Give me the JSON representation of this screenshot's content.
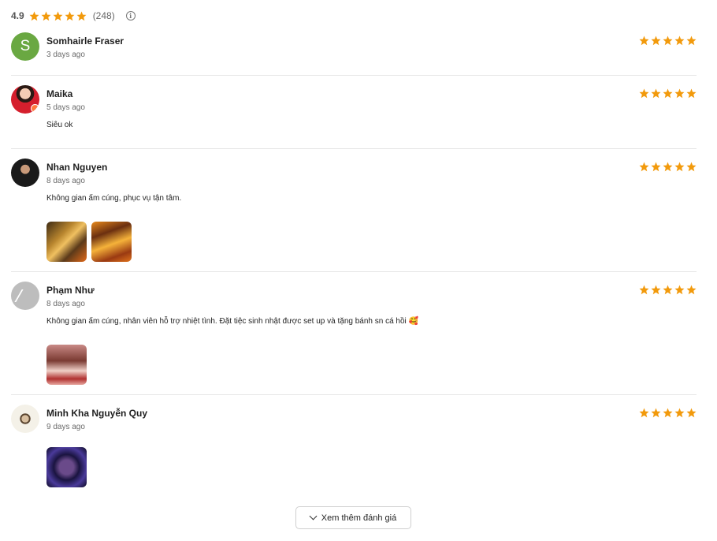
{
  "summary": {
    "rating": "4.9",
    "count": "(248)",
    "stars": 5,
    "info_icon": "info-icon"
  },
  "star_color": "#f29a0c",
  "reviews": [
    {
      "name": "Somhairle Fraser",
      "time": "3 days ago",
      "rating": 5,
      "comment": "",
      "avatar_letter": "S"
    },
    {
      "name": "Maika",
      "time": "5 days ago",
      "rating": 5,
      "comment": "Siêu ok"
    },
    {
      "name": "Nhan Nguyen",
      "time": "8 days ago",
      "rating": 5,
      "comment": "Không gian ấm cúng, phục vụ tận tâm.",
      "photos": 2
    },
    {
      "name": "Phạm Như",
      "time": "8 days ago",
      "rating": 5,
      "comment": "Không gian ấm cúng, nhân viên hỗ trợ nhiệt tình. Đặt tiệc sinh nhật được set up và tặng bánh sn cá hồi 🥰",
      "photos": 1
    },
    {
      "name": "Minh Kha Nguyễn Quy",
      "time": "9 days ago",
      "rating": 5,
      "comment": "",
      "photos": 1
    }
  ],
  "more_button": {
    "label": "Xem thêm đánh giá",
    "icon": "chevron-down-icon"
  }
}
